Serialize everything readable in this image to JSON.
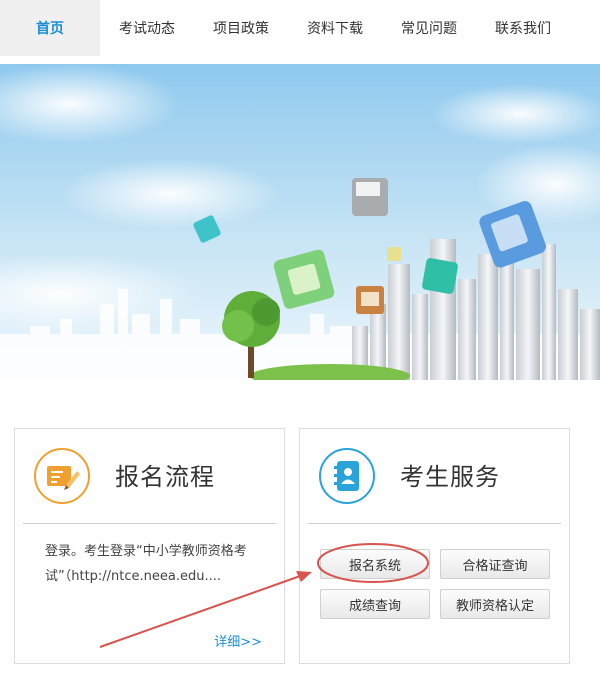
{
  "nav": {
    "items": [
      {
        "label": "首页",
        "active": true
      },
      {
        "label": "考试动态",
        "active": false
      },
      {
        "label": "项目政策",
        "active": false
      },
      {
        "label": "资料下载",
        "active": false
      },
      {
        "label": "常见问题",
        "active": false
      },
      {
        "label": "联系我们",
        "active": false
      }
    ]
  },
  "cards": {
    "registration": {
      "title": "报名流程",
      "text": "登录。考生登录“中小学教师资格考试”（http://ntce.neea.edu....",
      "more": "详细>>",
      "icon": "certificate-pencil-icon"
    },
    "services": {
      "title": "考生服务",
      "icon": "contact-book-icon",
      "buttons": [
        "报名系统",
        "合格证查询",
        "成绩查询",
        "教师资格认定"
      ]
    }
  },
  "colors": {
    "accent": "#1b8ed8",
    "annotation": "#d9534f",
    "icon_orange": "#f0a030",
    "icon_blue": "#29a3d8"
  }
}
